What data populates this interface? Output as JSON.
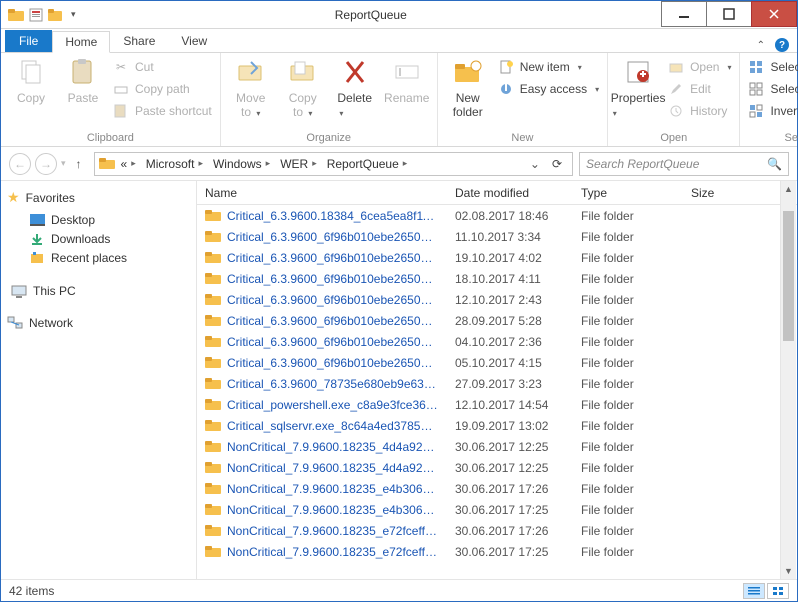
{
  "title": "ReportQueue",
  "menu": {
    "file": "File",
    "home": "Home",
    "share": "Share",
    "view": "View"
  },
  "ribbon": {
    "clipboard": {
      "label": "Clipboard",
      "copy": "Copy",
      "paste": "Paste",
      "cut": "Cut",
      "copy_path": "Copy path",
      "paste_shortcut": "Paste shortcut"
    },
    "organize": {
      "label": "Organize",
      "move_to": "Move\nto",
      "copy_to": "Copy\nto",
      "delete": "Delete",
      "rename": "Rename"
    },
    "new": {
      "label": "New",
      "new_folder": "New\nfolder",
      "new_item": "New item",
      "easy_access": "Easy access"
    },
    "open": {
      "label": "Open",
      "properties": "Properties",
      "open": "Open",
      "edit": "Edit",
      "history": "History"
    },
    "select": {
      "label": "Select",
      "select_all": "Select all",
      "select_none": "Select none",
      "invert": "Invert selection"
    }
  },
  "breadcrumb": [
    "Microsoft",
    "Windows",
    "WER",
    "ReportQueue"
  ],
  "search_placeholder": "Search ReportQueue",
  "nav": {
    "favorites": "Favorites",
    "desktop": "Desktop",
    "downloads": "Downloads",
    "recent": "Recent places",
    "this_pc": "This PC",
    "network": "Network"
  },
  "columns": {
    "name": "Name",
    "date": "Date modified",
    "type": "Type",
    "size": "Size"
  },
  "type_folder": "File folder",
  "status_text": "42 items",
  "files": [
    {
      "name": "Critical_6.3.9600.18384_6cea5ea8f1199a2a...",
      "date": "02.08.2017 18:46"
    },
    {
      "name": "Critical_6.3.9600_6f96b010ebe26508e78bd...",
      "date": "11.10.2017 3:34"
    },
    {
      "name": "Critical_6.3.9600_6f96b010ebe26508e78bd...",
      "date": "19.10.2017 4:02"
    },
    {
      "name": "Critical_6.3.9600_6f96b010ebe26508e78bd...",
      "date": "18.10.2017 4:11"
    },
    {
      "name": "Critical_6.3.9600_6f96b010ebe26508e78bd...",
      "date": "12.10.2017 2:43"
    },
    {
      "name": "Critical_6.3.9600_6f96b010ebe26508e78bd...",
      "date": "28.09.2017 5:28"
    },
    {
      "name": "Critical_6.3.9600_6f96b010ebe26508e78bd...",
      "date": "04.10.2017 2:36"
    },
    {
      "name": "Critical_6.3.9600_6f96b010ebe26508e78bd...",
      "date": "05.10.2017 4:15"
    },
    {
      "name": "Critical_6.3.9600_78735e680eb9e634d1221...",
      "date": "27.09.2017 3:23"
    },
    {
      "name": "Critical_powershell.exe_c8a9e3fce3693e5...",
      "date": "12.10.2017 14:54"
    },
    {
      "name": "Critical_sqlservr.exe_8c64a4ed3785dd2e8...",
      "date": "19.09.2017 13:02"
    },
    {
      "name": "NonCritical_7.9.9600.18235_4d4a9285a2d...",
      "date": "30.06.2017 12:25"
    },
    {
      "name": "NonCritical_7.9.9600.18235_4d4a9285a2d...",
      "date": "30.06.2017 12:25"
    },
    {
      "name": "NonCritical_7.9.9600.18235_e4b3061182fe...",
      "date": "30.06.2017 17:26"
    },
    {
      "name": "NonCritical_7.9.9600.18235_e4b3061182fe...",
      "date": "30.06.2017 17:25"
    },
    {
      "name": "NonCritical_7.9.9600.18235_e72fceff55eae...",
      "date": "30.06.2017 17:26"
    },
    {
      "name": "NonCritical_7.9.9600.18235_e72fceff55eae...",
      "date": "30.06.2017 17:25"
    }
  ]
}
